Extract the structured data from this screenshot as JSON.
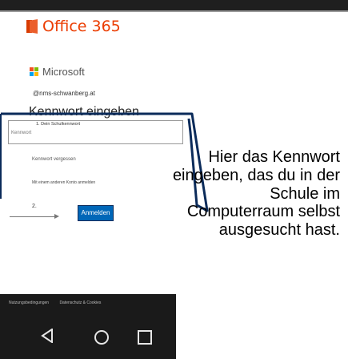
{
  "header": {
    "brand": "Office 365",
    "logo_icon": "office-logo-icon"
  },
  "login": {
    "provider": "Microsoft",
    "provider_icon": "microsoft-logo-icon",
    "account": "@nms-schwanberg.at",
    "title": "Kennwort eingeben",
    "password_tag": "1. Dein Schulkennwort",
    "password_placeholder": "Kennwort",
    "forgot_link": "Kennwort vergessen",
    "other_account_link": "Mit einem anderen Konto anmelden",
    "step_label": "2.",
    "signin_button": "Anmelden"
  },
  "instruction": "Hier das Kennwort eingeben, das du in der Schule im Computerraum selbst ausgesucht hast.",
  "navbar": {
    "links": [
      "Nutzungsbedingungen",
      "Datenschutz & Cookies"
    ],
    "back_icon": "back-icon",
    "home_icon": "home-icon",
    "recents_icon": "recents-icon"
  },
  "colors": {
    "office_orange": "#eb3c00",
    "signin_blue": "#0067b8",
    "callout_blue": "#0b2b5a"
  }
}
